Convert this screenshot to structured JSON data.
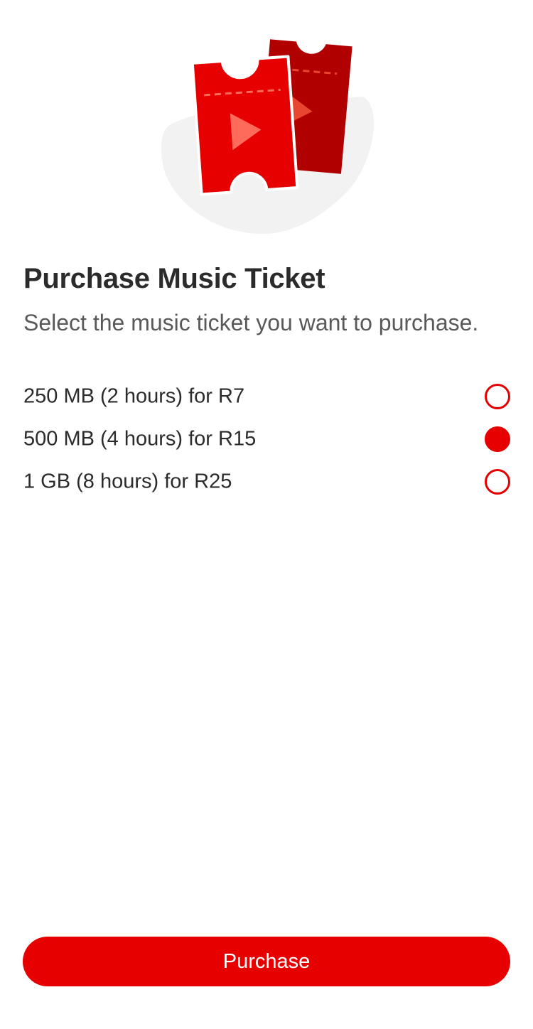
{
  "illustration": {
    "icon": "music-ticket-icon",
    "colors": {
      "backdrop": "#f2f2f2",
      "front_ticket": "#e60000",
      "back_ticket": "#b00000",
      "front_play": "#ff6b5a",
      "back_play": "#e8462e"
    }
  },
  "header": {
    "title": "Purchase Music Ticket",
    "subtitle": "Select the music ticket you want to purchase."
  },
  "options": [
    {
      "label": "250 MB (2 hours) for R7",
      "selected": false
    },
    {
      "label": "500 MB (4 hours) for R15",
      "selected": true
    },
    {
      "label": "1 GB (8 hours) for R25",
      "selected": false
    }
  ],
  "footer": {
    "purchase_label": "Purchase"
  },
  "colors": {
    "accent": "#e60000",
    "title_text": "#2b2b2b",
    "subtitle_text": "#595959"
  }
}
